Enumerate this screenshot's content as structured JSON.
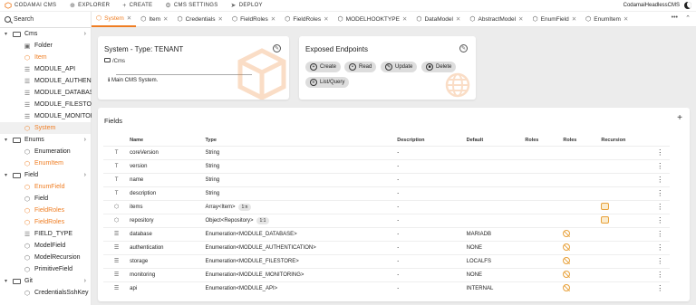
{
  "topbar": {
    "brand": "CODAMAI CMS",
    "nav": [
      {
        "icon": "explorer-icon",
        "glyph": "⊕",
        "label": "EXPLORER"
      },
      {
        "icon": "plus-icon",
        "glyph": "+",
        "label": "CREATE"
      },
      {
        "icon": "gear-icon",
        "glyph": "⚙",
        "label": "CMS SETTINGS"
      },
      {
        "icon": "deploy-icon",
        "glyph": "➤",
        "label": "DEPLOY"
      }
    ],
    "user": "CodamaiHeadlessCMS"
  },
  "sidebar": {
    "search_label": "Search",
    "items": [
      {
        "label": "Cms",
        "kind": "folder",
        "indent": 0,
        "color": "normal"
      },
      {
        "label": "Folder",
        "kind": "leaf",
        "indent": 1,
        "color": "normal",
        "glyph": "▣"
      },
      {
        "label": "Item",
        "kind": "leaf",
        "indent": 1,
        "color": "orange",
        "glyph": "⬡",
        "sel": true
      },
      {
        "label": "MODULE_API",
        "kind": "leaf",
        "indent": 1,
        "color": "normal",
        "glyph": "☰"
      },
      {
        "label": "MODULE_AUTHEN...",
        "kind": "leaf",
        "indent": 1,
        "color": "normal",
        "glyph": "☰"
      },
      {
        "label": "MODULE_DATABASE",
        "kind": "leaf",
        "indent": 1,
        "color": "normal",
        "glyph": "☰"
      },
      {
        "label": "MODULE_FILESTORE",
        "kind": "leaf",
        "indent": 1,
        "color": "normal",
        "glyph": "☰"
      },
      {
        "label": "MODULE_MONITOR...",
        "kind": "leaf",
        "indent": 1,
        "color": "normal",
        "glyph": "☰"
      },
      {
        "label": "System",
        "kind": "leaf",
        "indent": 1,
        "color": "orange",
        "glyph": "⬡",
        "sel": true
      },
      {
        "label": "Enums",
        "kind": "folder",
        "indent": 0,
        "color": "normal"
      },
      {
        "label": "Enumeration",
        "kind": "leaf",
        "indent": 1,
        "color": "normal",
        "glyph": "⬡"
      },
      {
        "label": "EnumItem",
        "kind": "leaf",
        "indent": 1,
        "color": "orange",
        "glyph": "⬡",
        "sel": true
      },
      {
        "label": "Field",
        "kind": "folder",
        "indent": 0,
        "color": "normal"
      },
      {
        "label": "EnumField",
        "kind": "leaf",
        "indent": 1,
        "color": "orange",
        "glyph": "⬡",
        "sel": true
      },
      {
        "label": "Field",
        "kind": "leaf",
        "indent": 1,
        "color": "normal",
        "glyph": "⬡"
      },
      {
        "label": "FieldRoles",
        "kind": "leaf",
        "indent": 1,
        "color": "orange",
        "glyph": "⬡",
        "sel": true
      },
      {
        "label": "FieldRoles",
        "kind": "leaf",
        "indent": 1,
        "color": "orange",
        "glyph": "⬡",
        "sel": true
      },
      {
        "label": "FIELD_TYPE",
        "kind": "leaf",
        "indent": 1,
        "color": "normal",
        "glyph": "☰"
      },
      {
        "label": "ModelField",
        "kind": "leaf",
        "indent": 1,
        "color": "normal",
        "glyph": "⬡"
      },
      {
        "label": "ModelRecursion",
        "kind": "leaf",
        "indent": 1,
        "color": "normal",
        "glyph": "⬡"
      },
      {
        "label": "PrimitiveField",
        "kind": "leaf",
        "indent": 1,
        "color": "normal",
        "glyph": "⬡"
      },
      {
        "label": "Git",
        "kind": "folder",
        "indent": 0,
        "color": "normal"
      },
      {
        "label": "CredentialsSshKey",
        "kind": "leaf",
        "indent": 1,
        "color": "normal",
        "glyph": "⬡"
      }
    ]
  },
  "tabs": [
    {
      "label": "System",
      "active": true
    },
    {
      "label": "Item"
    },
    {
      "label": "Credentials"
    },
    {
      "label": "FieldRoles"
    },
    {
      "label": "FieldRoles"
    },
    {
      "label": "MODELHOOKTYPE"
    },
    {
      "label": "DataModel"
    },
    {
      "label": "AbstractModel"
    },
    {
      "label": "EnumField"
    },
    {
      "label": "EnumItem"
    }
  ],
  "model_card": {
    "title": "System - Type: TENANT",
    "path": "/Cms",
    "description": "Main CMS System."
  },
  "endpoints": {
    "title": "Exposed Endpoints",
    "buttons": [
      "Create",
      "Read",
      "Update",
      "Delete",
      "List/Query"
    ]
  },
  "fields": {
    "title": "Fields",
    "headers": [
      "Name",
      "Type",
      "Description",
      "Default",
      "Roles",
      "Roles",
      "Recursion"
    ],
    "rows": [
      {
        "icon": "T",
        "name": "coreVersion",
        "type": "String",
        "chip": "",
        "desc": "-",
        "default": "",
        "roles": "",
        "recursion": ""
      },
      {
        "icon": "T",
        "name": "version",
        "type": "String",
        "chip": "",
        "desc": "-",
        "default": "",
        "roles": "",
        "recursion": ""
      },
      {
        "icon": "T",
        "name": "name",
        "type": "String",
        "chip": "",
        "desc": "-",
        "default": "",
        "roles": "",
        "recursion": ""
      },
      {
        "icon": "T",
        "name": "description",
        "type": "String",
        "chip": "",
        "desc": "-",
        "default": "",
        "roles": "",
        "recursion": ""
      },
      {
        "icon": "⬡",
        "name": "items",
        "type": "Array<Item>",
        "chip": "1:n",
        "desc": "-",
        "default": "",
        "roles": "",
        "recursion": "badge"
      },
      {
        "icon": "⬡",
        "name": "repository",
        "type": "Object<Repository>",
        "chip": "1:1",
        "desc": "-",
        "default": "",
        "roles": "",
        "recursion": "badge"
      },
      {
        "icon": "☰",
        "name": "database",
        "type": "Enumeration<MODULE_DATABASE>",
        "chip": "",
        "desc": "-",
        "default": "MARIADB",
        "roles": "ban",
        "recursion": ""
      },
      {
        "icon": "☰",
        "name": "authentication",
        "type": "Enumeration<MODULE_AUTHENTICATION>",
        "chip": "",
        "desc": "-",
        "default": "NONE",
        "roles": "ban",
        "recursion": ""
      },
      {
        "icon": "☰",
        "name": "storage",
        "type": "Enumeration<MODULE_FILESTORE>",
        "chip": "",
        "desc": "-",
        "default": "LOCALFS",
        "roles": "ban",
        "recursion": ""
      },
      {
        "icon": "☰",
        "name": "monitoring",
        "type": "Enumeration<MODULE_MONITORING>",
        "chip": "",
        "desc": "-",
        "default": "NONE",
        "roles": "ban",
        "recursion": ""
      },
      {
        "icon": "☰",
        "name": "api",
        "type": "Enumeration<MODULE_API>",
        "chip": "",
        "desc": "-",
        "default": "INTERNAL",
        "roles": "ban",
        "recursion": ""
      }
    ]
  },
  "colors": {
    "accent": "#ef7d22"
  }
}
